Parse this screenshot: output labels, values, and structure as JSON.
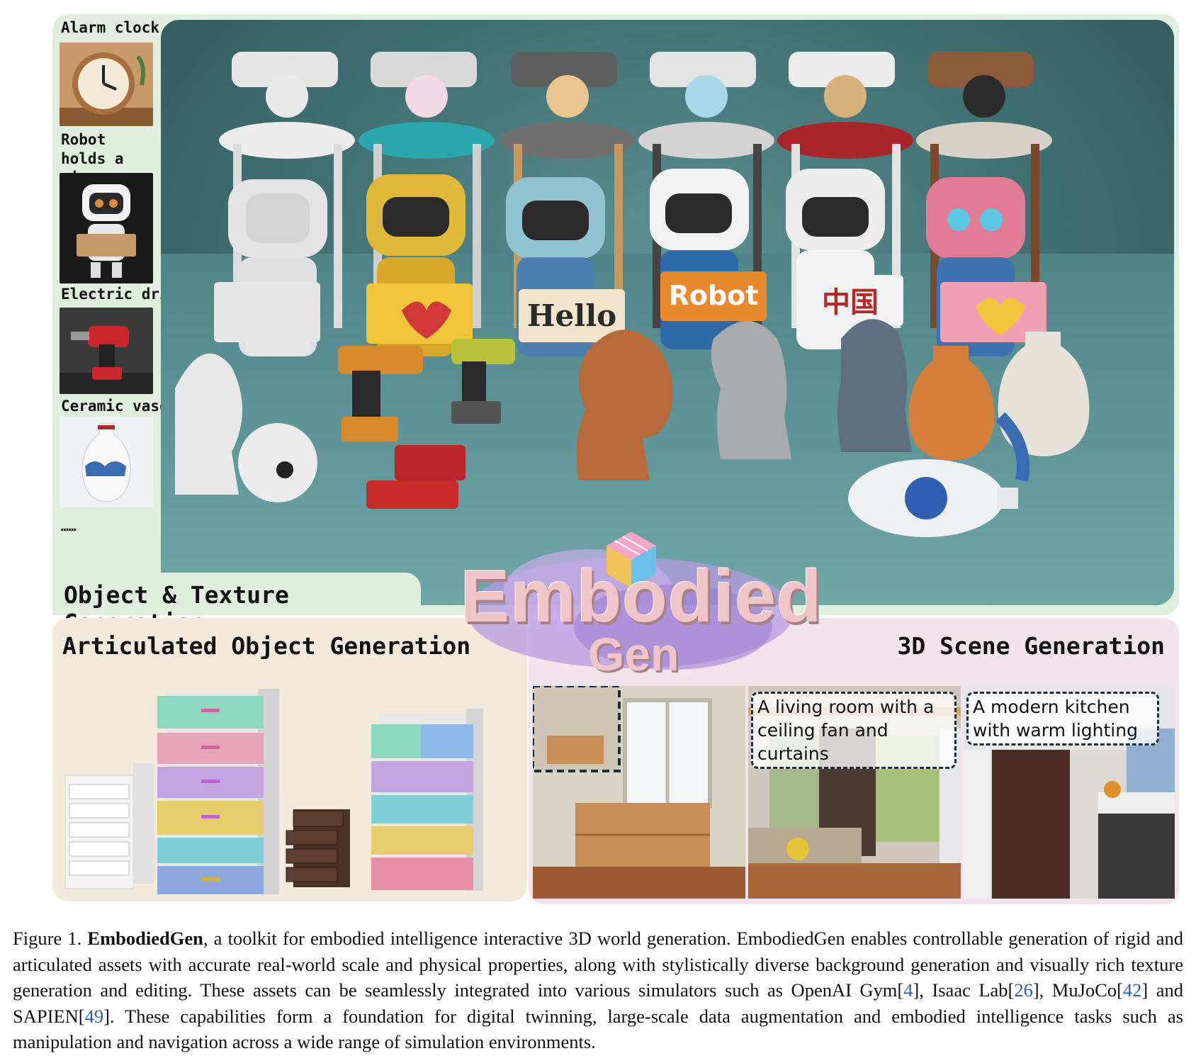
{
  "prompts": {
    "items": [
      {
        "label": "Alarm clock"
      },
      {
        "label": "Robot holds a sign"
      },
      {
        "label": "Electric drill"
      },
      {
        "label": "Ceramic vase"
      }
    ],
    "ellipsis": "……"
  },
  "render_signs": [
    "Hello",
    "Robot",
    "中国"
  ],
  "sections": {
    "object_texture": "Object & Texture Generation",
    "articulated": "Articulated Object Generation",
    "scene": "3D Scene Generation"
  },
  "logo": {
    "word": "Embodied",
    "sub": "Gen"
  },
  "scene_prompts": [
    "A living room with a ceiling fan and curtains",
    "A modern kitchen with warm lighting"
  ],
  "caption": {
    "label": "Figure 1.",
    "name": "EmbodiedGen",
    "text_1": ", a toolkit for embodied intelligence interactive 3D world generation. EmbodiedGen enables controllable generation of rigid and articulated assets with accurate real-world scale and physical properties, along with stylistically diverse background generation and visually rich texture generation and editing. These assets can be seamlessly integrated into various simulators such as OpenAI Gym[",
    "cite_1": "4",
    "text_2": "], Isaac Lab[",
    "cite_2": "26",
    "text_3": "], MuJoCo[",
    "cite_3": "42",
    "text_4": "] and SAPIEN[",
    "cite_4": "49",
    "text_5": "]. These capabilities form a foundation for digital twinning, large-scale data augmentation and embodied intelligence tasks such as manipulation and navigation across a wide range of simulation environments."
  },
  "colors": {
    "object_panel_bg": "#dfeedd",
    "articulated_panel_bg": "#f3eadb",
    "scene_panel_bg": "#f1e4ea",
    "citation": "#2a5db0"
  }
}
